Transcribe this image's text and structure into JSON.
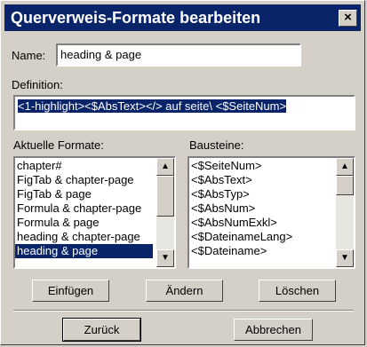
{
  "dialog": {
    "title": "Querverweis-Formate bearbeiten",
    "close_glyph": "×"
  },
  "name": {
    "label": "Name:",
    "value": "heading & page"
  },
  "definition": {
    "label": "Definition:",
    "value": "<1-highlight><$AbsText></> auf seite\\ <$SeiteNum>"
  },
  "formats": {
    "label": "Aktuelle Formate:",
    "items": [
      "chapter#",
      "FigTab & chapter-page",
      "FigTab & page",
      "Formula & chapter-page",
      "Formula & page",
      "heading & chapter-page",
      "heading & page"
    ],
    "selected": "heading & page"
  },
  "blocks": {
    "label": "Bausteine:",
    "items": [
      "<$SeiteNum>",
      "<$AbsText>",
      "<$AbsTyp>",
      "<$AbsNum>",
      "<$AbsNumExkl>",
      "<$DateinameLang>",
      "<$Dateiname>"
    ]
  },
  "buttons": {
    "insert": "Einfügen",
    "change": "Ändern",
    "delete": "Löschen",
    "back": "Zurück",
    "cancel": "Abbrechen"
  },
  "icons": {
    "scroll_up": "arrow-up-icon",
    "scroll_down": "arrow-down-icon",
    "close": "close-icon"
  }
}
